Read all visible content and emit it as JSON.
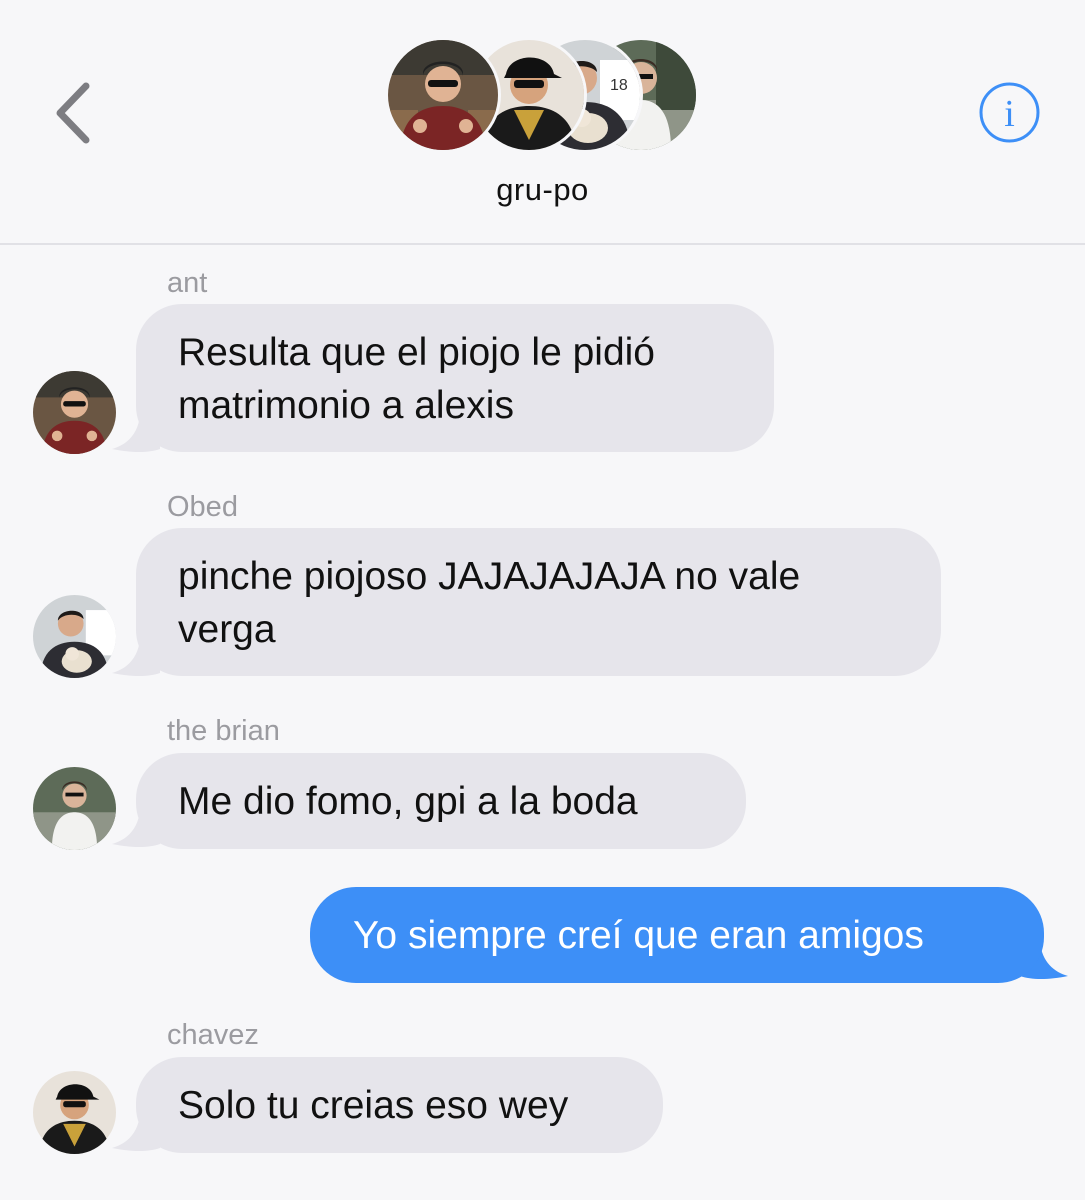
{
  "header": {
    "group_name": "gru-po",
    "back_icon": "chevron-left-icon",
    "info_icon": "info-icon",
    "info_glyph": "i",
    "accent": "#3d8ff7"
  },
  "messages": [
    {
      "sender": "ant",
      "lines": [
        "Resulta que el piojo le pidió",
        "matrimonio a alexis"
      ]
    },
    {
      "sender": "Obed",
      "lines": [
        "pinche piojoso JAJAJAJAJA no vale",
        "verga"
      ]
    },
    {
      "sender": "the brian",
      "lines": [
        "Me dio fomo, gpi a la boda"
      ]
    },
    {
      "sender": "",
      "outgoing": true,
      "lines": [
        "Yo siempre creí que eran amigos"
      ]
    },
    {
      "sender": "chavez",
      "lines": [
        "Solo tu creias eso wey"
      ]
    }
  ],
  "colors": {
    "incoming_bubble": "#e6e5eb",
    "outgoing_bubble": "#3d8ff7",
    "sender_label": "#9b9ba0"
  }
}
